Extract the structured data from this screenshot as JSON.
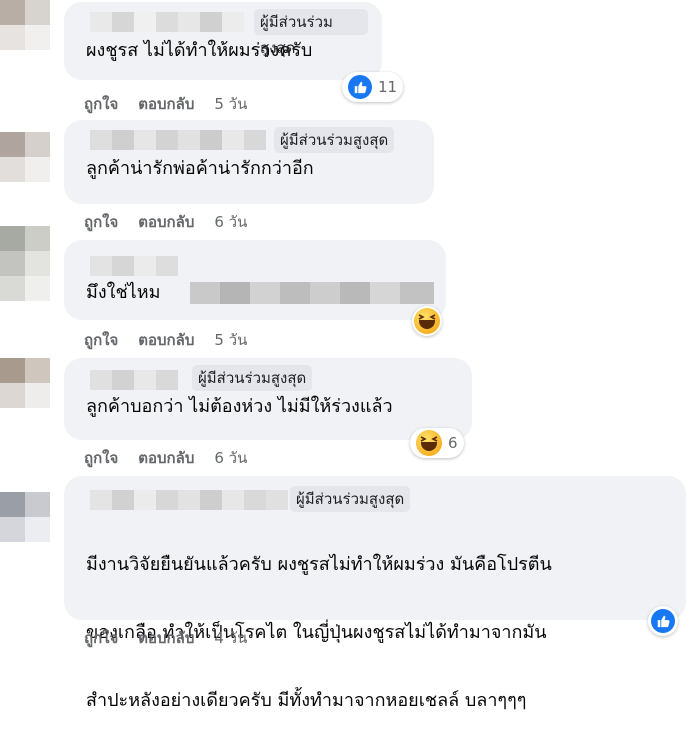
{
  "actions": {
    "like": "ถูกใจ",
    "reply": "ตอบกลับ"
  },
  "comments": [
    {
      "badge": "ผู้มีส่วนร่วมสูงสุด",
      "text": "ผงชูรส  ไม่ได้ทำให้ผมร่วงครับ",
      "time": "5 วัน",
      "reaction": {
        "icon": "like-icon",
        "count": "11"
      }
    },
    {
      "badge": "ผู้มีส่วนร่วมสูงสุด",
      "text": "ลูกค้าน่ารักพ่อค้าน่ารักกว่าอีก",
      "time": "6 วัน"
    },
    {
      "text": "มึงใช่ไหม",
      "time": "5 วัน",
      "reaction": {
        "icon": "haha-icon",
        "count": ""
      }
    },
    {
      "badge": "ผู้มีส่วนร่วมสูงสุด",
      "text": "ลูกค้าบอกว่า  ไม่ต้องห่วง  ไม่มีให้ร่วงแล้ว",
      "time": "6 วัน",
      "reaction": {
        "icon": "haha-icon",
        "count": "6"
      }
    },
    {
      "badge": "ผู้มีส่วนร่วมสูงสุด",
      "text_lines": [
        "มีงานวิจัยยืนยันแล้วครับ  ผงชูรสไม่ทำให้ผมร่วง  มันคือโปรตีน",
        "ของเกลือ  ทำให้เป็นโรคไต  ในญี่ปุ่นผงชูรสไม่ได้ทำมาจากมัน",
        "สำปะหลังอย่างเดียวครับ  มีทั้งทำมาจากหอยเชลล์  บลาๆๆๆ"
      ],
      "time": "4 วัน",
      "reaction": {
        "icon": "like-icon",
        "count": ""
      }
    }
  ],
  "colors": {
    "bubble": "#f0f2f5",
    "badge": "#e4e6eb",
    "meta": "#65676b",
    "like": "#1877f2"
  }
}
